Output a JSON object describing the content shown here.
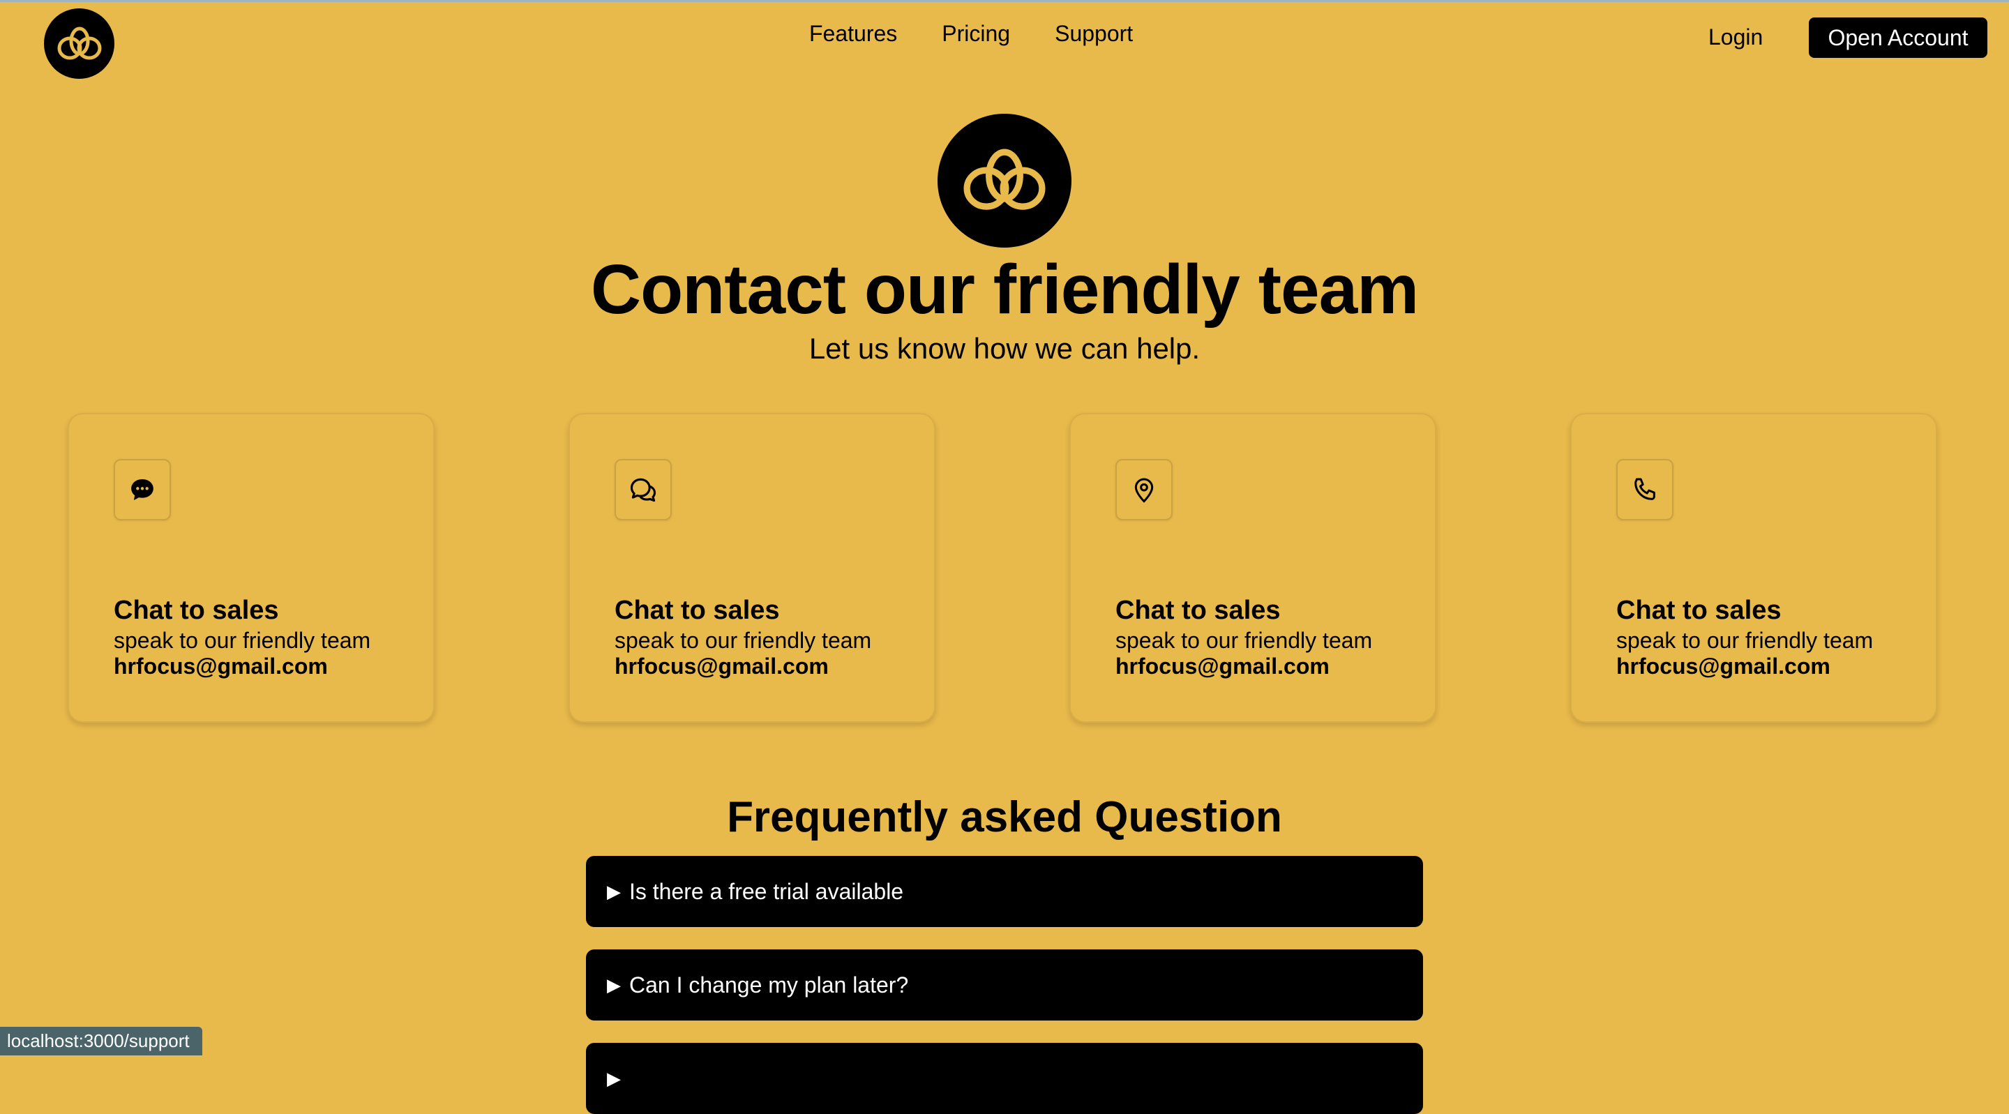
{
  "header": {
    "logo_icon": "flower-knot-logo",
    "nav": [
      "Features",
      "Pricing",
      "Support"
    ],
    "login_label": "Login",
    "cta_label": "Open Account"
  },
  "hero": {
    "title": "Contact our friendly team",
    "subtitle": "Let us know how we can help."
  },
  "cards": [
    {
      "icon": "chat-bubble-icon",
      "title": "Chat to sales",
      "desc": "speak to our friendly team",
      "email": "hrfocus@gmail.com"
    },
    {
      "icon": "chat-outline-icon",
      "title": "Chat to sales",
      "desc": "speak to our friendly team",
      "email": "hrfocus@gmail.com"
    },
    {
      "icon": "location-pin-icon",
      "title": "Chat to sales",
      "desc": "speak to our friendly team",
      "email": "hrfocus@gmail.com"
    },
    {
      "icon": "phone-icon",
      "title": "Chat to sales",
      "desc": "speak to our friendly team",
      "email": "hrfocus@gmail.com"
    }
  ],
  "faq": {
    "title": "Frequently asked Question",
    "items": [
      "Is there a free trial available",
      "Can I change my plan later?",
      ""
    ]
  },
  "status_bar": "localhost:3000/support",
  "colors": {
    "background": "#e8b94b",
    "dark": "#000000",
    "accent": "#e8b94b"
  }
}
